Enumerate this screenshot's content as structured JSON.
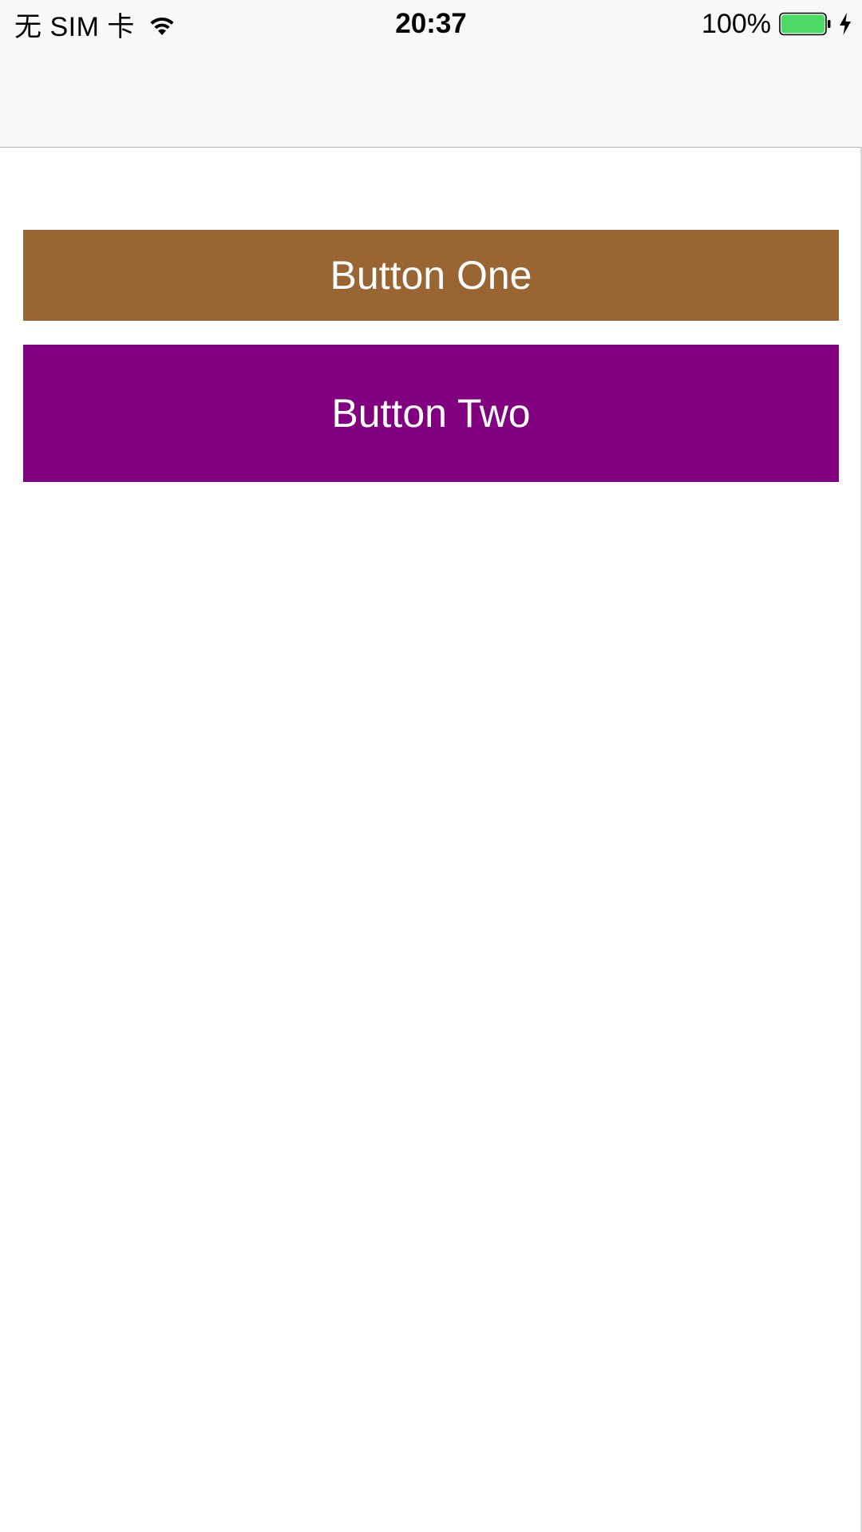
{
  "status_bar": {
    "carrier": "无 SIM 卡",
    "time": "20:37",
    "battery_percent": "100%",
    "battery_level": 1.0,
    "battery_color": "#4cd964",
    "icons": [
      "wifi-icon",
      "battery-icon",
      "charging-bolt-icon"
    ]
  },
  "buttons": [
    {
      "label": "Button One",
      "color": "#996633"
    },
    {
      "label": "Button Two",
      "color": "#800080"
    }
  ],
  "colors": {
    "nav_bar_background": "#f8f8f8",
    "page_background": "#ffffff",
    "button_text": "#ffffff"
  }
}
